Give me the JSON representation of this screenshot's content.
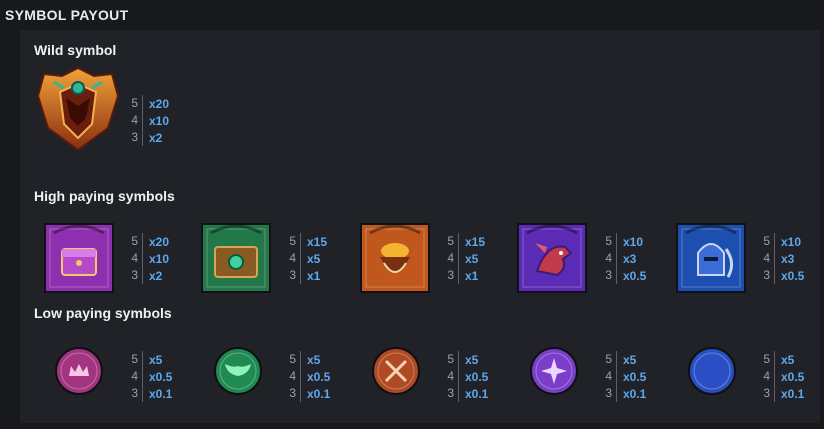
{
  "title": "SYMBOL PAYOUT",
  "sections": {
    "wild": {
      "title": "Wild symbol",
      "symbols": [
        {
          "icon": "wild-crest-icon",
          "payouts": [
            {
              "count": "5",
              "mult": "x20"
            },
            {
              "count": "4",
              "mult": "x10"
            },
            {
              "count": "3",
              "mult": "x2"
            }
          ]
        }
      ]
    },
    "high": {
      "title": "High paying symbols",
      "symbols": [
        {
          "icon": "treasure-chest-icon",
          "color": "#8e2fb0",
          "payouts": [
            {
              "count": "5",
              "mult": "x20"
            },
            {
              "count": "4",
              "mult": "x10"
            },
            {
              "count": "3",
              "mult": "x2"
            }
          ]
        },
        {
          "icon": "spellbook-icon",
          "color": "#23784a",
          "payouts": [
            {
              "count": "5",
              "mult": "x15"
            },
            {
              "count": "4",
              "mult": "x5"
            },
            {
              "count": "3",
              "mult": "x1"
            }
          ]
        },
        {
          "icon": "gold-pouch-icon",
          "color": "#c0581d",
          "payouts": [
            {
              "count": "5",
              "mult": "x15"
            },
            {
              "count": "4",
              "mult": "x5"
            },
            {
              "count": "3",
              "mult": "x1"
            }
          ]
        },
        {
          "icon": "dragon-icon",
          "color": "#5c2bb5",
          "payouts": [
            {
              "count": "5",
              "mult": "x10"
            },
            {
              "count": "4",
              "mult": "x3"
            },
            {
              "count": "3",
              "mult": "x0.5"
            }
          ]
        },
        {
          "icon": "knight-helmet-icon",
          "color": "#1d4fb0",
          "payouts": [
            {
              "count": "5",
              "mult": "x10"
            },
            {
              "count": "4",
              "mult": "x3"
            },
            {
              "count": "3",
              "mult": "x0.5"
            }
          ]
        }
      ]
    },
    "low": {
      "title": "Low paying symbols",
      "symbols": [
        {
          "icon": "crown-rune-icon",
          "color": "#a3347f",
          "payouts": [
            {
              "count": "5",
              "mult": "x5"
            },
            {
              "count": "4",
              "mult": "x0.5"
            },
            {
              "count": "3",
              "mult": "x0.1"
            }
          ]
        },
        {
          "icon": "wings-rune-icon",
          "color": "#1f8a52",
          "payouts": [
            {
              "count": "5",
              "mult": "x5"
            },
            {
              "count": "4",
              "mult": "x0.5"
            },
            {
              "count": "3",
              "mult": "x0.1"
            }
          ]
        },
        {
          "icon": "swords-rune-icon",
          "color": "#b04a24",
          "payouts": [
            {
              "count": "5",
              "mult": "x5"
            },
            {
              "count": "4",
              "mult": "x0.5"
            },
            {
              "count": "3",
              "mult": "x0.1"
            }
          ]
        },
        {
          "icon": "star-rune-icon",
          "color": "#7a3ec9",
          "payouts": [
            {
              "count": "5",
              "mult": "x5"
            },
            {
              "count": "4",
              "mult": "x0.5"
            },
            {
              "count": "3",
              "mult": "x0.1"
            }
          ]
        },
        {
          "icon": "moon-rune-icon",
          "color": "#2a4fc4",
          "payouts": [
            {
              "count": "5",
              "mult": "x5"
            },
            {
              "count": "4",
              "mult": "x0.5"
            },
            {
              "count": "3",
              "mult": "x0.1"
            }
          ]
        }
      ]
    }
  }
}
